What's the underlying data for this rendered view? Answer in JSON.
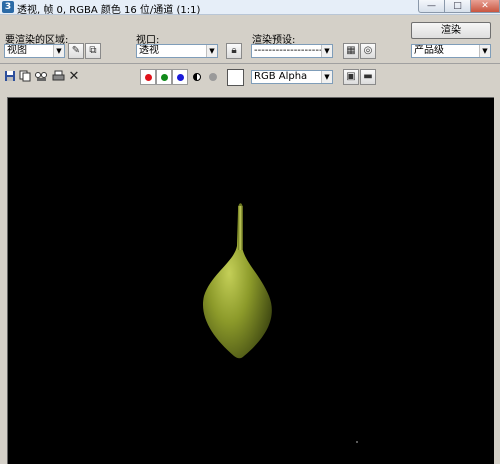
{
  "window": {
    "title": "透视, 帧 0, RGBA 颜色 16 位/通道 (1:1)",
    "app_icon": "3ds-max-icon",
    "min_symbol": "—",
    "max_symbol": "□",
    "close_symbol": "✕"
  },
  "area": {
    "label": "要渲染的区域:",
    "value": "视图"
  },
  "viewport_select": {
    "label": "视口:",
    "value": "透视"
  },
  "preset": {
    "label": "渲染预设:",
    "value": "-------------------------"
  },
  "render": {
    "button_label": "渲染",
    "quality_value": "产品级"
  },
  "toolbar": {
    "channel_display": "RGB Alpha",
    "red_color": "#e0121b",
    "green_color": "#118a1a",
    "blue_color": "#1a1ad8"
  },
  "render_output": {
    "background_color": "#000000",
    "object_color": "#8c9a2a"
  }
}
